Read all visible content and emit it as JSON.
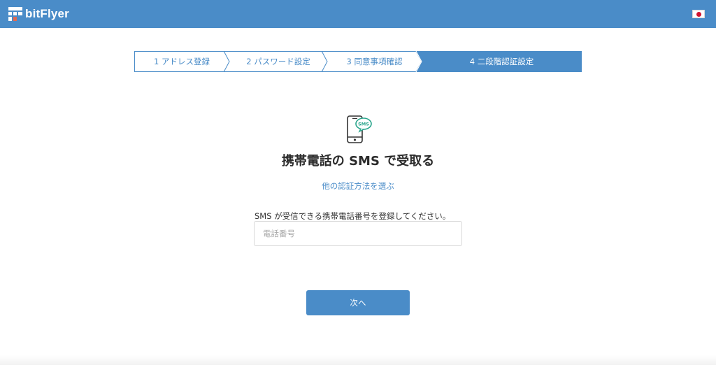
{
  "header": {
    "brand": "bitFlyer",
    "logo_icon": "bitflyer-logo-icon",
    "flag_icon": "japan-flag-icon",
    "color": "#4a8cc8"
  },
  "steps": [
    {
      "label": "1 アドレス登録",
      "active": false
    },
    {
      "label": "2 パスワード設定",
      "active": false
    },
    {
      "label": "3 同意事項確認",
      "active": false
    },
    {
      "label": "4 二段階認証設定",
      "active": true
    }
  ],
  "main": {
    "icon": "sms-phone-icon",
    "icon_badge": "SMS",
    "title": "携帯電話の SMS で受取る",
    "alt_link": "他の認証方法を選ぶ",
    "field_label": "SMS が受信できる携帯電話番号を登録してください。",
    "phone_placeholder": "電話番号",
    "phone_value": "",
    "next_label": "次へ"
  },
  "colors": {
    "accent": "#4a8cc8",
    "badge": "#2aa58c"
  }
}
